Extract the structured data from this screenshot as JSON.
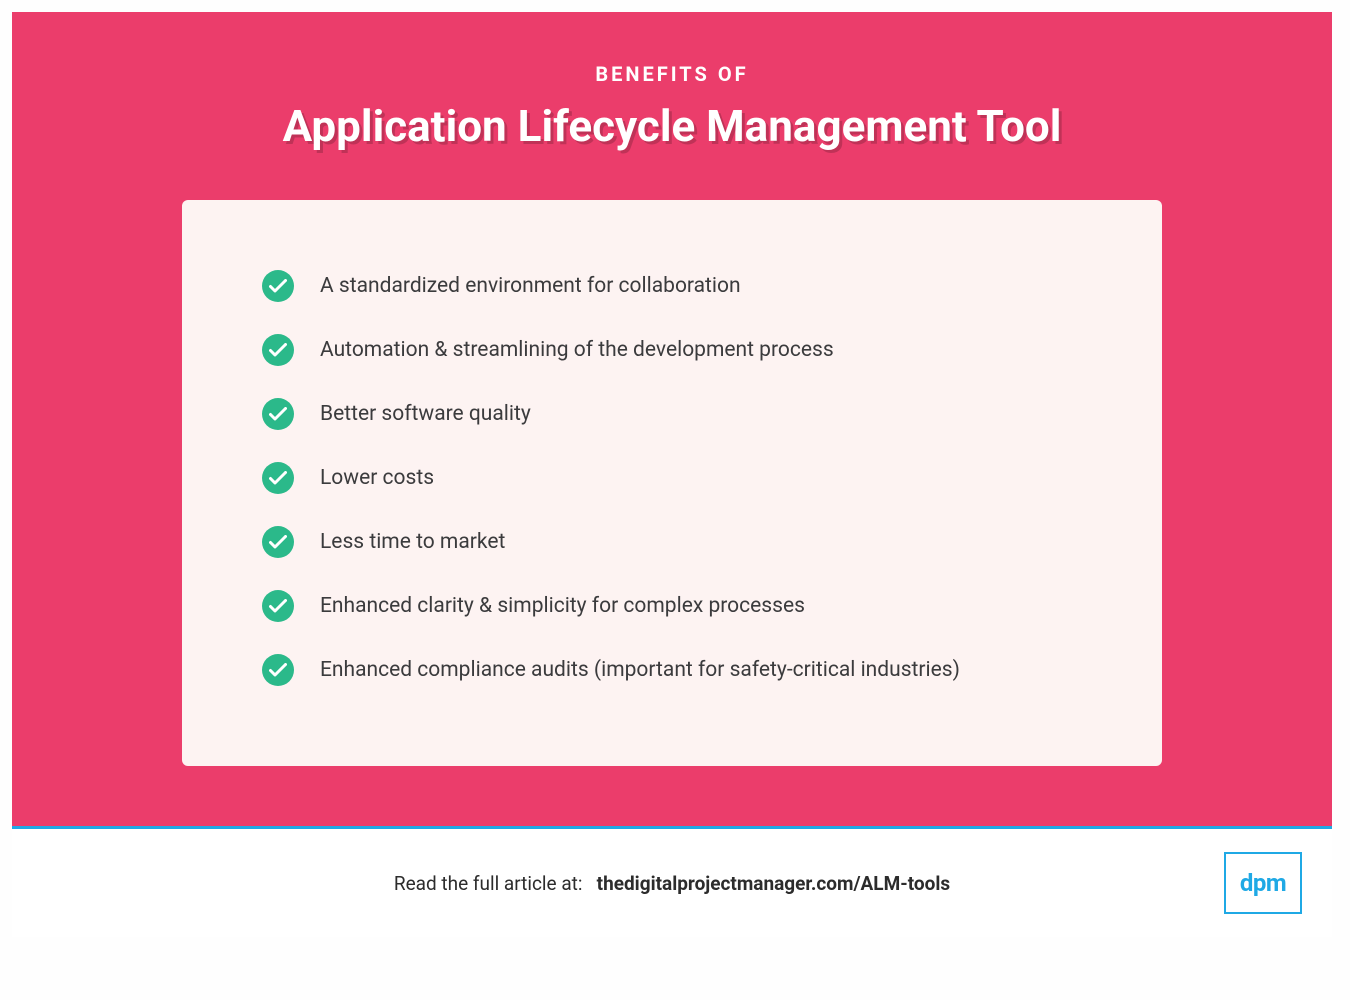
{
  "header": {
    "eyebrow": "BENEFITS OF",
    "title": "Application Lifecycle Management Tool"
  },
  "benefits": [
    "A standardized environment for collaboration",
    "Automation & streamlining of the development process",
    "Better software quality",
    "Lower costs",
    "Less time to market",
    "Enhanced clarity & simplicity for complex processes",
    "Enhanced compliance audits (important for safety-critical industries)"
  ],
  "footer": {
    "lead": "Read the full article at:",
    "link": "thedigitalprojectmanager.com/ALM-tools",
    "logo": "dpm"
  },
  "colors": {
    "hero_bg": "#eb3d6b",
    "card_bg": "#fdf3f2",
    "check_bg": "#2bb98a",
    "divider": "#1fa9e5",
    "logo_border": "#1fa9e5"
  }
}
